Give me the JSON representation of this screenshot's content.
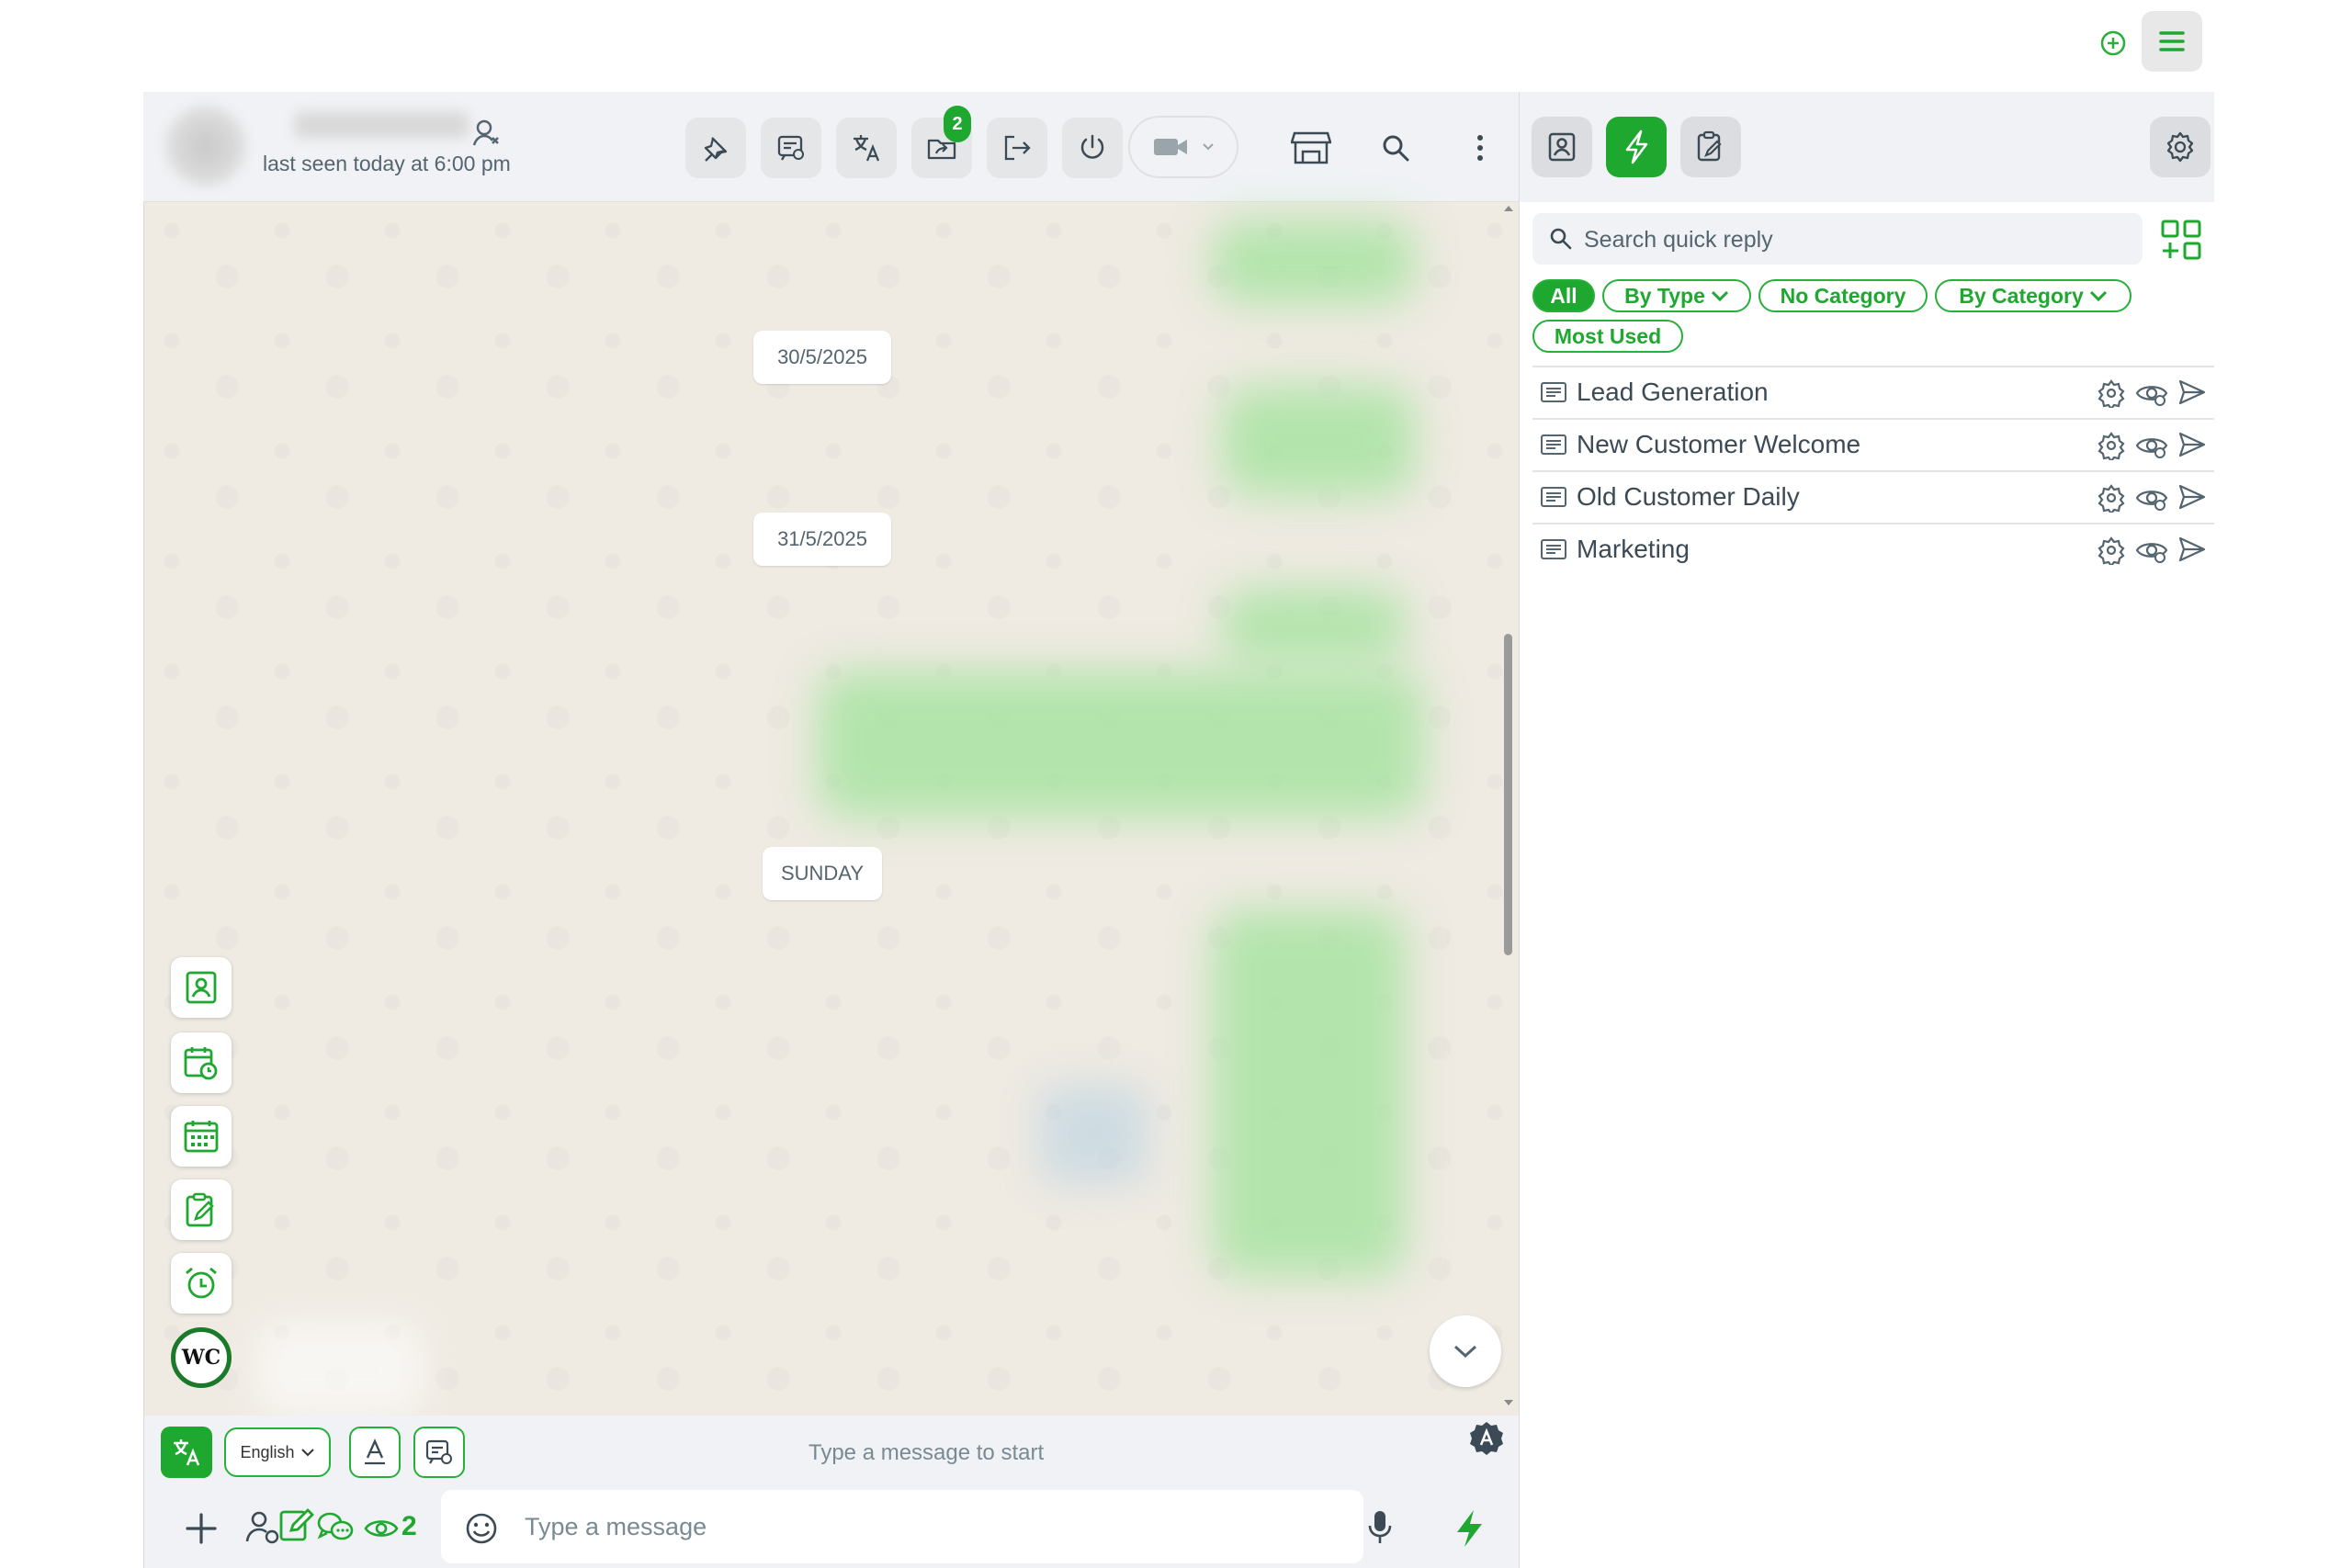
{
  "header": {
    "last_seen": "last seen today at 6:00 pm",
    "badge_count": "2"
  },
  "messages": {
    "dates": [
      "30/5/2025",
      "31/5/2025",
      "SUNDAY"
    ]
  },
  "composer": {
    "language": "English",
    "hint": "Type a message to start",
    "placeholder": "Type a message",
    "eye_count": "2"
  },
  "quick_reply": {
    "search_placeholder": "Search quick reply",
    "filters": [
      "All",
      "By Type",
      "No Category",
      "By Category",
      "Most Used"
    ],
    "items": [
      "Lead Generation",
      "New Customer Welcome",
      "Old Customer Daily",
      "Marketing"
    ]
  },
  "colors": {
    "accent": "#1fa82f",
    "chat_bg": "#efeae2",
    "header_bg": "#f0f2f5"
  }
}
